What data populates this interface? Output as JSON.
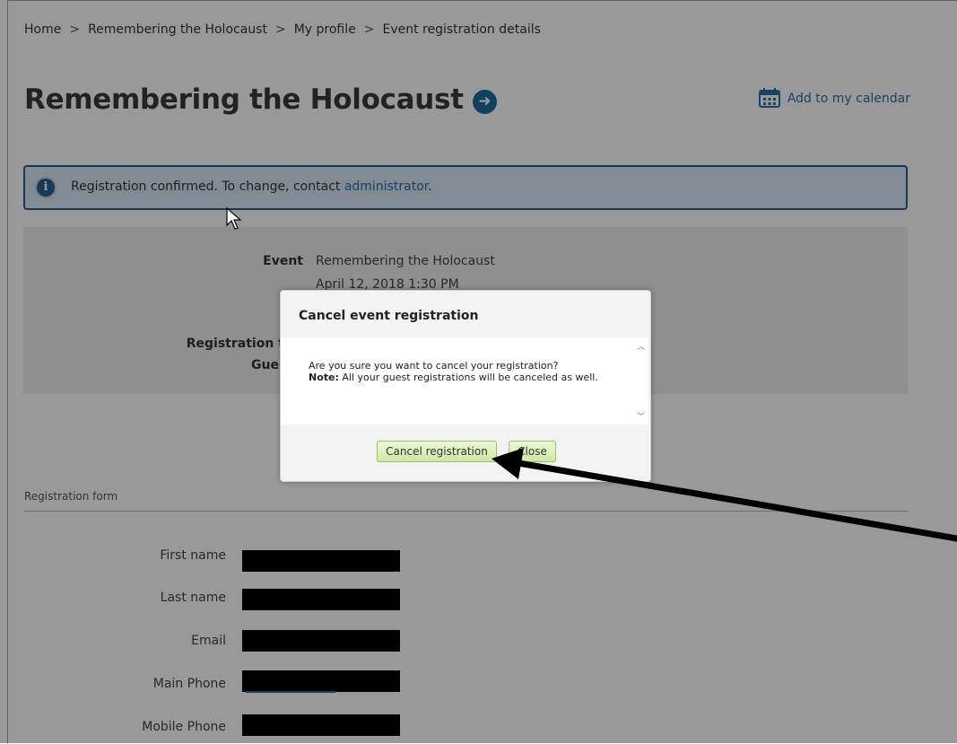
{
  "breadcrumb": {
    "items": [
      "Home",
      "Remembering the Holocaust",
      "My profile",
      "Event registration details"
    ],
    "separator": ">"
  },
  "page": {
    "title": "Remembering the Holocaust",
    "title_icon": "arrow-right-circle-icon",
    "calendar_link": "Add to my calendar",
    "calendar_icon": "calendar-icon"
  },
  "notice": {
    "icon": "info-icon",
    "text": "Registration confirmed. To change, contact ",
    "link": "administrator",
    "suffix": "."
  },
  "details": {
    "event_label": "Event",
    "event_value": "Remembering the Holocaust",
    "date_value": "April 12, 2018 1:30 PM",
    "registration_type_label": "Registration ty",
    "guest_label": "Guest"
  },
  "form": {
    "section_title": "Registration form",
    "fields": [
      "First name",
      "Last name",
      "Email",
      "Main Phone",
      "Mobile Phone"
    ]
  },
  "dialog": {
    "title": "Cancel event registration",
    "line1": "Are you sure you want to cancel your registration?",
    "note_label": "Note:",
    "note_text": " All your guest registrations will be canceled as well.",
    "confirm_button": "Cancel registration",
    "close_button": "Close"
  },
  "colors": {
    "accent": "#2a6ea6",
    "button": "#cfe8a4",
    "overlay": "rgba(0,0,0,0.40)"
  }
}
